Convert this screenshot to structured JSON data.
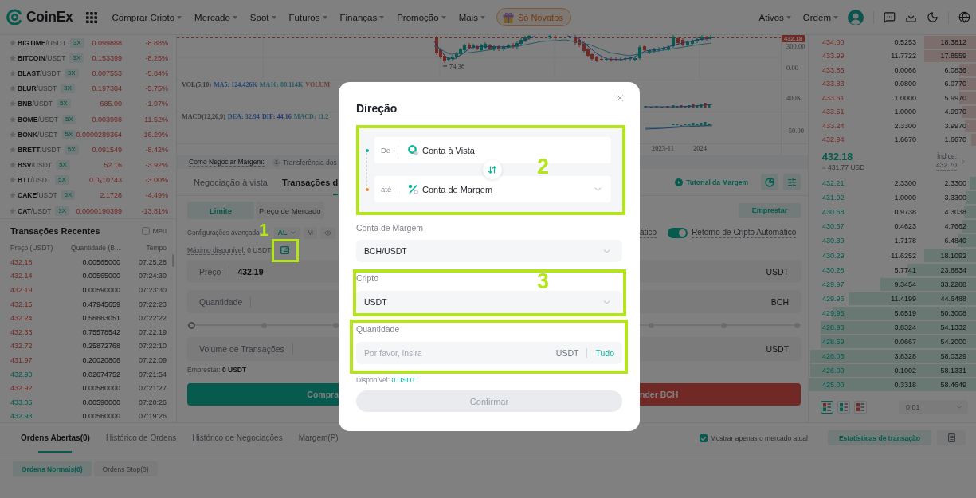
{
  "nav": {
    "logo": "CoinEx",
    "menu": [
      "Comprar Cripto",
      "Mercado",
      "Spot",
      "Futuros",
      "Finanças",
      "Promoção",
      "Mais"
    ],
    "promo": "Só Novatos",
    "account_menu": [
      "Ativos",
      "Ordem"
    ]
  },
  "markets": [
    {
      "base": "BIGTIME",
      "quote": "/USDT",
      "leverage": "3X",
      "price": "0.099888",
      "change": "-8.88%",
      "up": false
    },
    {
      "base": "BITCOIN",
      "quote": "/USDT",
      "leverage": "3X",
      "price": "0.153399",
      "change": "-8.25%",
      "up": false
    },
    {
      "base": "BLAST",
      "quote": "/USDT",
      "leverage": "3X",
      "price": "0.007553",
      "change": "-5.84%",
      "up": false
    },
    {
      "base": "BLUR",
      "quote": "/USDT",
      "leverage": "3X",
      "price": "0.197384",
      "change": "-5.75%",
      "up": false
    },
    {
      "base": "BNB",
      "quote": "/USDT",
      "leverage": "5X",
      "price": "685.00",
      "change": "-1.97%",
      "up": false
    },
    {
      "base": "BOME",
      "quote": "/USDT",
      "leverage": "5X",
      "price": "0.003998",
      "change": "-11.52%",
      "up": false
    },
    {
      "base": "BONK",
      "quote": "/USDT",
      "leverage": "5X",
      "price": "0.0000289364",
      "change": "-16.29%",
      "up": false
    },
    {
      "base": "BRETT",
      "quote": "/USDT",
      "leverage": "5X",
      "price": "0.091549",
      "change": "-8.42%",
      "up": false
    },
    {
      "base": "BSV",
      "quote": "/USDT",
      "leverage": "5X",
      "price": "52.16",
      "change": "-3.92%",
      "up": false
    },
    {
      "base": "BTT",
      "quote": "/USDT",
      "leverage": "5X",
      "price": "0.0$_{5}$10743",
      "change": "-3.00%",
      "up": false
    },
    {
      "base": "CAKE",
      "quote": "/USDT",
      "leverage": "5X",
      "price": "2.1726",
      "change": "-4.49%",
      "up": false
    },
    {
      "base": "CAT",
      "quote": "/USDT",
      "leverage": "3X",
      "price": "0.0000190399",
      "change": "-13.81%",
      "up": false
    }
  ],
  "recent_trades": {
    "title": "Transações Recentes",
    "mine": {
      "label": "Meu",
      "checked": false
    },
    "columns": [
      "Preço (USDT)",
      "Quantidade (B...",
      "Tempo"
    ],
    "rows": [
      {
        "price": "432.18",
        "amount": "0.00565000",
        "time": "07:25:28",
        "buy": false
      },
      {
        "price": "432.14",
        "amount": "0.00565000",
        "time": "07:24:30",
        "buy": false
      },
      {
        "price": "432.19",
        "amount": "0.00590000",
        "time": "07:23:30",
        "buy": false
      },
      {
        "price": "432.15",
        "amount": "0.47945659",
        "time": "07:22:23",
        "buy": false
      },
      {
        "price": "432.24",
        "amount": "0.56663051",
        "time": "07:22:22",
        "buy": false
      },
      {
        "price": "432.33",
        "amount": "0.75578542",
        "time": "07:22:19",
        "buy": false
      },
      {
        "price": "432.72",
        "amount": "0.25872768",
        "time": "07:22:10",
        "buy": false
      },
      {
        "price": "431.97",
        "amount": "0.20020806",
        "time": "07:22:09",
        "buy": false
      },
      {
        "price": "432.90",
        "amount": "0.02874752",
        "time": "07:21:54",
        "buy": true
      },
      {
        "price": "432.92",
        "amount": "0.00580000",
        "time": "07:21:27",
        "buy": false
      },
      {
        "price": "433.05",
        "amount": "0.00590000",
        "time": "07:20:26",
        "buy": true
      },
      {
        "price": "432.93",
        "amount": "0.00560000",
        "time": "07:19:26",
        "buy": true
      }
    ]
  },
  "chart": {
    "price_tag": "432.18",
    "price_axis": [
      "300.00",
      "0.00"
    ],
    "volume_axis": "400K",
    "macd_axis": "-50.00",
    "low_label": "74.36",
    "dates": [
      "2023-11",
      "2024"
    ],
    "volume_legend": [
      {
        "text": "VOL(5,10)",
        "color": "#383838"
      },
      {
        "text": "MA5: 124.426K",
        "color": "#23457a"
      },
      {
        "text": "MA10: 80.114K",
        "color": "#285a64"
      },
      {
        "text": "VOLUM",
        "color": "#703c38"
      }
    ],
    "macd_legend": [
      {
        "text": "MACD(12,26,9)",
        "color": "#383838"
      },
      {
        "text": "DEA: 32.94",
        "color": "#23457a"
      },
      {
        "text": "DIF: 44.16",
        "color": "#1e3c78"
      },
      {
        "text": "MACD: 11.2",
        "color": "#285a64"
      }
    ]
  },
  "guide": {
    "title": "Como Negociar Margem:",
    "step": "1",
    "text": "Transferência dos"
  },
  "trade_tabs": [
    {
      "label": "Negociação à vista",
      "selected": false
    },
    {
      "label": "Transações d",
      "selected": true
    }
  ],
  "tutorial": "Tutorial da Margem",
  "order_types": [
    {
      "label": "Limite",
      "selected": true
    },
    {
      "label": "Preço de Mercado",
      "selected": false
    }
  ],
  "borrow_button": "Emprestar",
  "buy_form": {
    "settings": "Configurações avançada",
    "mode": "AL",
    "mode_alt": "M",
    "max_label": "Máximo disponível:",
    "max_value": "0 USDT",
    "marker": "1",
    "fields": [
      {
        "label": "Preço",
        "value": "432.19"
      },
      {
        "label": "Quantidade"
      },
      {
        "label": "Volume de Transações"
      }
    ],
    "slider": {
      "level": 0
    },
    "borrow_label": "Emprestar:",
    "borrow_value": "0 USDT",
    "submit": "Compra"
  },
  "sell_form": {
    "auto_label": "ático",
    "auto_return": {
      "label": "Retorno de Cripto Automático",
      "on": true
    },
    "fields": [
      {
        "unit": "USDT"
      },
      {
        "unit": "BCH"
      },
      {
        "unit": "USDT"
      }
    ],
    "submit": "nder BCH"
  },
  "order_book": {
    "asks": [
      {
        "price": "434.00",
        "amount": "0.5253",
        "total": "18.3812",
        "level": 0.31
      },
      {
        "price": "433.99",
        "amount": "11.7722",
        "total": "17.8559",
        "level": 0.31
      },
      {
        "price": "433.86",
        "amount": "0.0066",
        "total": "6.0836",
        "level": 0.1
      },
      {
        "price": "433.83",
        "amount": "0.0800",
        "total": "6.0770",
        "level": 0.1
      },
      {
        "price": "433.61",
        "amount": "1.0000",
        "total": "5.9970",
        "level": 0.1
      },
      {
        "price": "433.51",
        "amount": "1.0000",
        "total": "4.9970",
        "level": 0.085
      },
      {
        "price": "433.24",
        "amount": "2.3300",
        "total": "3.9970",
        "level": 0.068
      },
      {
        "price": "432.94",
        "amount": "1.6670",
        "total": "1.6670",
        "level": 0.03
      }
    ],
    "last_price": "432.18",
    "last_price_usd": "≈ 431.77 USD",
    "index_label": "Índice:",
    "index_value": "432.70",
    "bids": [
      {
        "price": "432.21",
        "amount": "2.3300",
        "total": "2.3300",
        "level": 0.04
      },
      {
        "price": "431.92",
        "amount": "1.0000",
        "total": "3.3300",
        "level": 0.06
      },
      {
        "price": "430.68",
        "amount": "0.9738",
        "total": "4.3038",
        "level": 0.07
      },
      {
        "price": "430.67",
        "amount": "0.4623",
        "total": "4.7662",
        "level": 0.08
      },
      {
        "price": "430.30",
        "amount": "1.7178",
        "total": "6.4840",
        "level": 0.11
      },
      {
        "price": "430.29",
        "amount": "11.6252",
        "total": "18.1092",
        "level": 0.31
      },
      {
        "price": "430.28",
        "amount": "5.7741",
        "total": "23.8834",
        "level": 0.41
      },
      {
        "price": "429.97",
        "amount": "9.3454",
        "total": "33.2288",
        "level": 0.57
      },
      {
        "price": "429.96",
        "amount": "11.4199",
        "total": "44.6488",
        "level": 0.76
      },
      {
        "price": "429.95",
        "amount": "5.6519",
        "total": "50.3008",
        "level": 0.86
      },
      {
        "price": "428.93",
        "amount": "3.8324",
        "total": "54.1332",
        "level": 0.93
      },
      {
        "price": "428.59",
        "amount": "0.0667",
        "total": "54.2000",
        "level": 0.93
      },
      {
        "price": "426.06",
        "amount": "3.8328",
        "total": "58.0329",
        "level": 0.99
      },
      {
        "price": "426.00",
        "amount": "0.1002",
        "total": "58.1331",
        "level": 0.99
      },
      {
        "price": "425.00",
        "amount": "0.3318",
        "total": "58.4649",
        "level": 1
      }
    ],
    "layouts": [
      {
        "kind": "both",
        "selected": true
      },
      {
        "kind": "bids",
        "selected": false
      },
      {
        "kind": "asks",
        "selected": false
      }
    ],
    "precision": "0.01"
  },
  "orders": {
    "tabs": [
      {
        "label": "Ordens Abertas(0)",
        "selected": true
      },
      {
        "label": "Histórico de Ordens",
        "selected": false
      },
      {
        "label": "Histórico de Negociações",
        "selected": false
      },
      {
        "label": "Margem(P)",
        "selected": false
      }
    ],
    "current_market_only": {
      "label": "Mostrar apenas o mercado atual",
      "checked": true
    },
    "stats_button": "Estatísticas de transação",
    "sub_tabs": [
      {
        "label": "Ordens Normais(0)",
        "selected": true
      },
      {
        "label": "Ordens Stop(0)",
        "selected": false
      }
    ]
  },
  "modal": {
    "title": "Direção",
    "direction": {
      "highlighted": true,
      "marker": "2",
      "from": {
        "label": "De",
        "account": "Conta à Vista"
      },
      "to": {
        "label": "até",
        "account": "Conta de Margem"
      }
    },
    "margin_account": {
      "label": "Conta de Margem",
      "value": "BCH/USDT"
    },
    "asset": {
      "highlighted": true,
      "marker": "3",
      "label": "Cripto",
      "value": "USDT"
    },
    "amount": {
      "highlighted": true,
      "label": "Quantidade",
      "placeholder": "Por favor, insira",
      "unit": "USDT",
      "max_button": "Tudo"
    },
    "available": {
      "label": "Disponível:",
      "value": "0 USDT"
    },
    "confirm": {
      "label": "Confirmar",
      "disabled": true
    }
  }
}
